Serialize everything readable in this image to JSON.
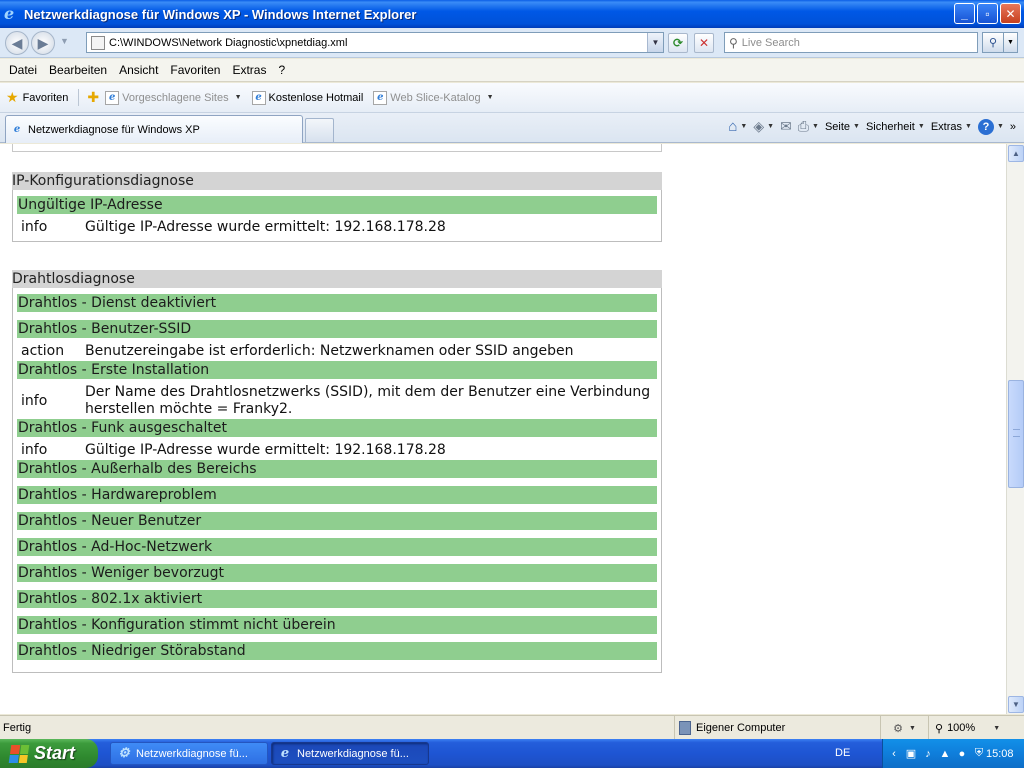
{
  "window": {
    "title": "Netzwerkdiagnose für Windows XP - Windows Internet Explorer",
    "minimize": "_",
    "maximize": "▫",
    "close": "✕"
  },
  "address": {
    "url": "C:\\WINDOWS\\Network Diagnostic\\xpnetdiag.xml",
    "search_placeholder": "Live Search"
  },
  "menu": [
    "Datei",
    "Bearbeiten",
    "Ansicht",
    "Favoriten",
    "Extras",
    "?"
  ],
  "favorites": {
    "label": "Favoriten",
    "links": [
      {
        "label": "Vorgeschlagene Sites",
        "dropdown": true,
        "dim": true
      },
      {
        "label": "Kostenlose Hotmail",
        "dropdown": false,
        "dim": false
      },
      {
        "label": "Web Slice-Katalog",
        "dropdown": true,
        "dim": true
      }
    ]
  },
  "tab": {
    "title": "Netzwerkdiagnose für Windows XP"
  },
  "command_bar": {
    "page": "Seite",
    "security": "Sicherheit",
    "tools": "Extras",
    "more": "»"
  },
  "content": {
    "ip_section": {
      "title": "IP-Konfigurationsdiagnose",
      "tests": [
        {
          "name": "Ungültige IP-Adresse",
          "details": [
            {
              "level": "info",
              "message": "Gültige IP-Adresse wurde ermittelt: 192.168.178.28"
            }
          ]
        }
      ]
    },
    "wireless_section": {
      "title": "Drahtlosdiagnose",
      "tests": [
        {
          "name": "Drahtlos - Dienst deaktiviert",
          "details": []
        },
        {
          "name": "Drahtlos - Benutzer-SSID",
          "details": [
            {
              "level": "action",
              "message": "Benutzereingabe ist erforderlich: Netzwerknamen oder SSID angeben"
            }
          ]
        },
        {
          "name": "Drahtlos - Erste Installation",
          "details": [
            {
              "level": "info",
              "message": "Der Name des Drahtlosnetzwerks (SSID), mit dem der Benutzer eine Verbindung herstellen möchte = Franky2."
            }
          ]
        },
        {
          "name": "Drahtlos - Funk ausgeschaltet",
          "details": [
            {
              "level": "info",
              "message": "Gültige IP-Adresse wurde ermittelt: 192.168.178.28"
            }
          ]
        },
        {
          "name": "Drahtlos - Außerhalb des Bereichs",
          "details": []
        },
        {
          "name": "Drahtlos - Hardwareproblem",
          "details": []
        },
        {
          "name": "Drahtlos - Neuer Benutzer",
          "details": []
        },
        {
          "name": "Drahtlos - Ad-Hoc-Netzwerk",
          "details": []
        },
        {
          "name": "Drahtlos - Weniger bevorzugt",
          "details": []
        },
        {
          "name": "Drahtlos - 802.1x aktiviert",
          "details": []
        },
        {
          "name": "Drahtlos - Konfiguration stimmt nicht überein",
          "details": []
        },
        {
          "name": "Drahtlos - Niedriger Störabstand",
          "details": []
        }
      ]
    }
  },
  "status": {
    "text": "Fertig",
    "zone": "Eigener Computer",
    "zoom": "100%"
  },
  "taskbar": {
    "start": "Start",
    "buttons": [
      "Netzwerkdiagnose fü...",
      "Netzwerkdiagnose fü..."
    ],
    "language": "DE",
    "clock": "15:08"
  },
  "colors": {
    "test_row": "#8fce8f",
    "section_header": "#d4d4d4",
    "titlebar": "#0058e6"
  }
}
